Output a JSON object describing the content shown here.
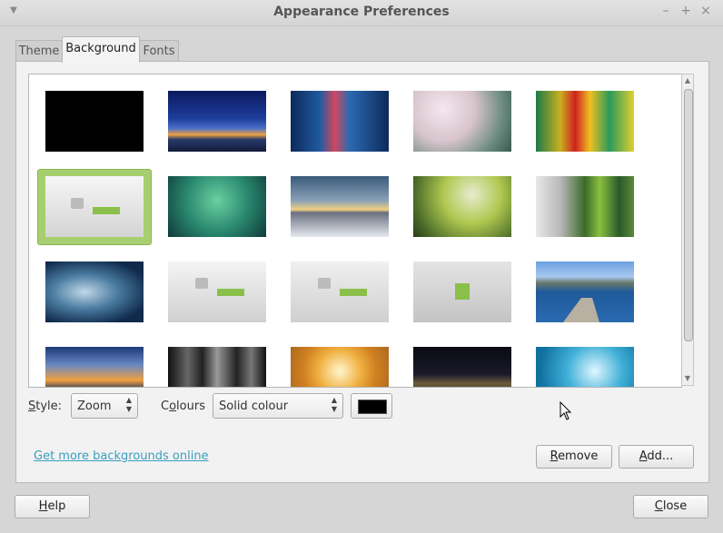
{
  "window": {
    "title": "Appearance Preferences",
    "menu_icon": "window-menu-icon",
    "controls": [
      "minimize-icon",
      "maximize-icon",
      "close-icon"
    ]
  },
  "tabs": [
    {
      "label": "Theme"
    },
    {
      "label": "Background",
      "active": true
    },
    {
      "label": "Fonts"
    }
  ],
  "gallery": {
    "selected_index": 5,
    "thumbnails": [
      "solid black",
      "blue dusk over sea",
      "city lights reflected in water",
      "cherry blossom trees",
      "colorful vertical blur",
      "mint logo on grey",
      "green blur",
      "sunset through bare trees",
      "green yellow gradient",
      "grey green streaks",
      "blue light blur",
      "mint logo on grey",
      "mint logo on grey",
      "green box on grey",
      "lake pier with mountains",
      "sunset over sea",
      "night city black and white",
      "golden sky above clouds",
      "city skyline at night",
      "cyan bokeh blur"
    ]
  },
  "style": {
    "label_prefix": "",
    "label_mnemonic": "S",
    "label_rest": "tyle:",
    "value": "Zoom"
  },
  "colours": {
    "label_prefix": "C",
    "label_mnemonic": "o",
    "label_rest": "lours",
    "value": "Solid colour",
    "color": "#000000"
  },
  "link": "Get more backgrounds online",
  "buttons": {
    "remove_mnemonic": "R",
    "remove_rest": "emove",
    "add_mnemonic": "A",
    "add_rest": "dd...",
    "help_mnemonic": "H",
    "help_rest": "elp",
    "close_mnemonic": "C",
    "close_rest": "lose"
  }
}
